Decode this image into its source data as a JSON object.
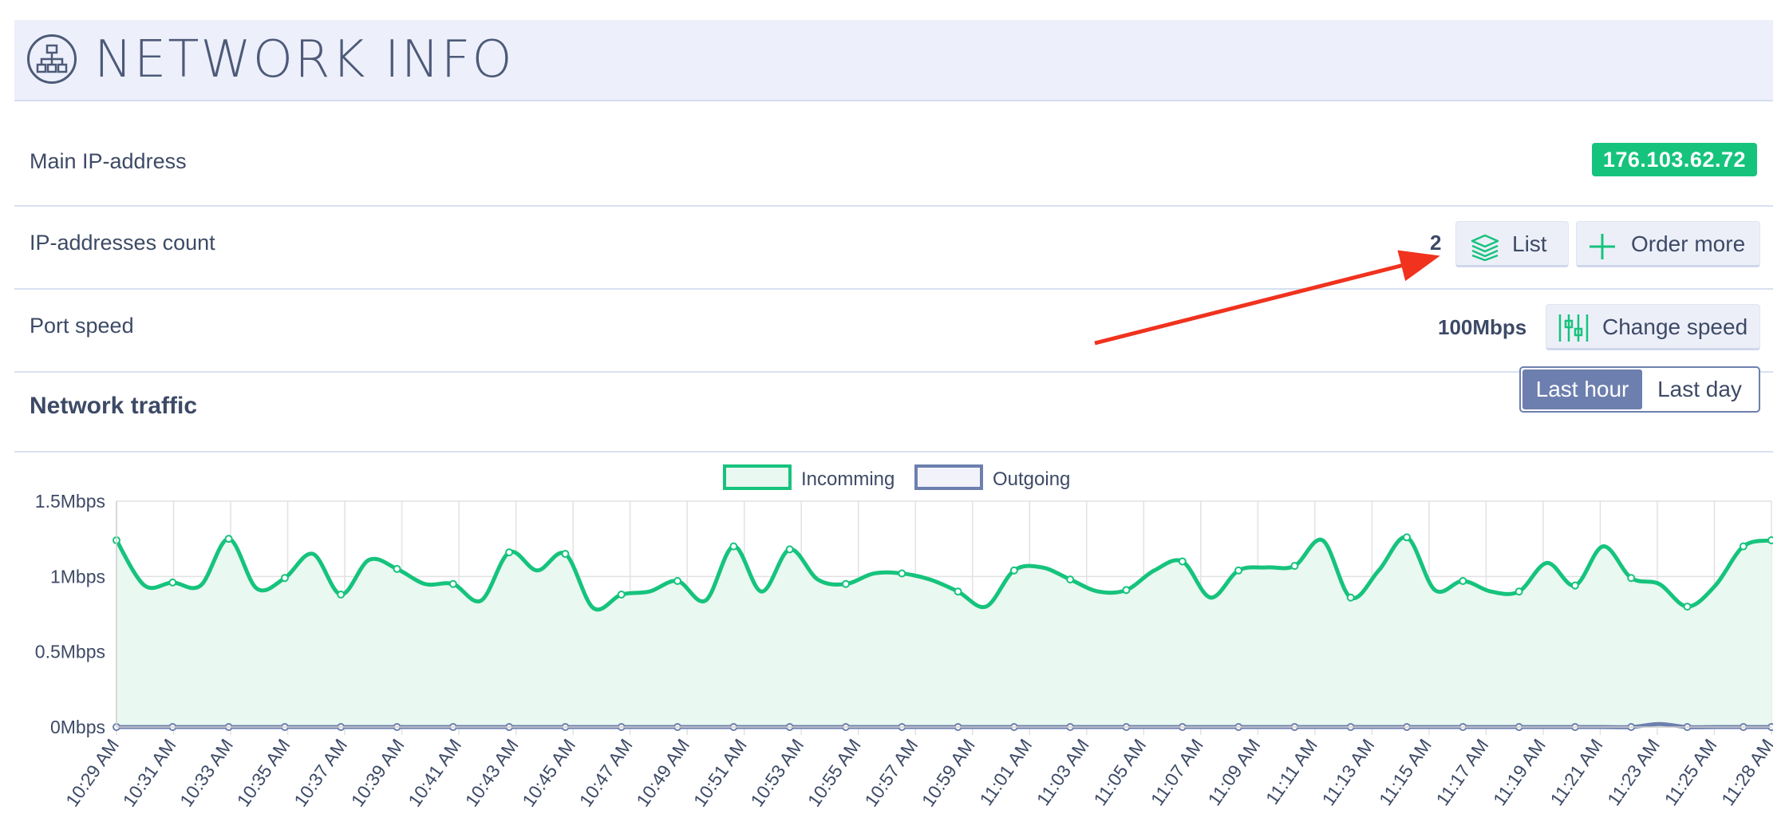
{
  "header": {
    "title": "NETWORK INFO",
    "icon": "network-icon"
  },
  "rows": {
    "main_ip": {
      "label": "Main IP-address",
      "value": "176.103.62.72"
    },
    "ip_count": {
      "label": "IP-addresses count",
      "value": "2",
      "list_label": "List",
      "order_label": "Order more"
    },
    "port_speed": {
      "label": "Port speed",
      "value": "100Mbps",
      "change_label": "Change speed"
    }
  },
  "traffic": {
    "title": "Network traffic",
    "range_options": [
      "Last hour",
      "Last day"
    ],
    "selected_range": "Last hour"
  },
  "colors": {
    "accent_green": "#16c37d",
    "incoming_fill": "#e9f8f0",
    "outgoing": "#6c7fae",
    "header_bg": "#edf0fb"
  },
  "chart_data": {
    "type": "area",
    "ylim": [
      0,
      1.5
    ],
    "yticks": [
      "0Mbps",
      "0.5Mbps",
      "1Mbps",
      "1.5Mbps"
    ],
    "x_labels": [
      "10:29 AM",
      "10:31 AM",
      "10:33 AM",
      "10:35 AM",
      "10:37 AM",
      "10:39 AM",
      "10:41 AM",
      "10:43 AM",
      "10:45 AM",
      "10:47 AM",
      "10:49 AM",
      "10:51 AM",
      "10:53 AM",
      "10:55 AM",
      "10:57 AM",
      "10:59 AM",
      "11:01 AM",
      "11:03 AM",
      "11:05 AM",
      "11:07 AM",
      "11:09 AM",
      "11:11 AM",
      "11:13 AM",
      "11:15 AM",
      "11:17 AM",
      "11:19 AM",
      "11:21 AM",
      "11:23 AM",
      "11:25 AM",
      "11:28 AM"
    ],
    "legend": [
      "Incomming",
      "Outgoing"
    ],
    "legend_position": "top-center",
    "grid": true,
    "series": [
      {
        "name": "Incomming",
        "values": [
          1.24,
          0.94,
          0.96,
          0.94,
          1.25,
          0.92,
          0.99,
          1.15,
          0.88,
          1.11,
          1.05,
          0.95,
          0.95,
          0.84,
          1.16,
          1.04,
          1.15,
          0.79,
          0.88,
          0.9,
          0.97,
          0.84,
          1.2,
          0.9,
          1.18,
          0.98,
          0.95,
          1.02,
          1.02,
          0.98,
          0.9,
          0.8,
          1.04,
          1.06,
          0.98,
          0.9,
          0.91,
          1.04,
          1.1,
          0.86,
          1.04,
          1.06,
          1.07,
          1.24,
          0.86,
          1.04,
          1.26,
          0.91,
          0.97,
          0.9,
          0.9,
          1.09,
          0.94,
          1.2,
          0.99,
          0.95,
          0.8,
          0.94,
          1.2,
          1.24
        ]
      },
      {
        "name": "Outgoing",
        "values": [
          0,
          0,
          0,
          0,
          0,
          0,
          0,
          0,
          0,
          0,
          0,
          0,
          0,
          0,
          0,
          0,
          0,
          0,
          0,
          0,
          0,
          0,
          0,
          0,
          0,
          0,
          0,
          0,
          0,
          0,
          0,
          0,
          0,
          0,
          0,
          0,
          0,
          0,
          0,
          0,
          0,
          0,
          0,
          0,
          0,
          0,
          0,
          0,
          0,
          0,
          0,
          0,
          0,
          0,
          0,
          0.02,
          0,
          0,
          0,
          0
        ]
      }
    ]
  }
}
